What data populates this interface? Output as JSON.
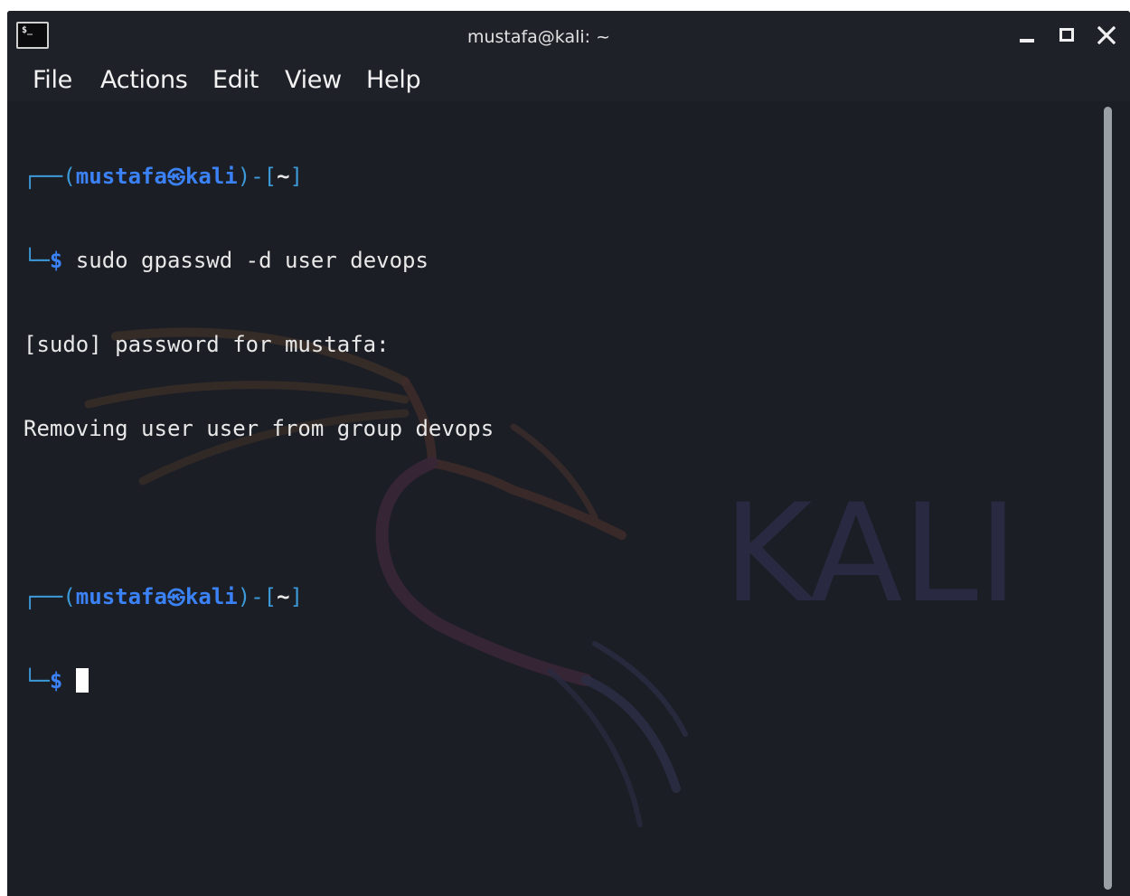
{
  "window": {
    "title": "mustafa@kali: ~",
    "icon": "terminal-icon",
    "icon_text": "$_"
  },
  "menu": [
    "File",
    "Actions",
    "Edit",
    "View",
    "Help"
  ],
  "prompt": {
    "user": "mustafa",
    "host": "kali",
    "path": "~",
    "symbol": "$"
  },
  "terminal": {
    "command1": "sudo gpasswd -d user devops",
    "output1": "[sudo] password for mustafa:",
    "output2": "Removing user user from group devops"
  },
  "background": {
    "watermark": "KALI"
  },
  "colors": {
    "background": "#1c1e26",
    "prompt_accent": "#3b82f6",
    "text": "#e8e8e8"
  }
}
